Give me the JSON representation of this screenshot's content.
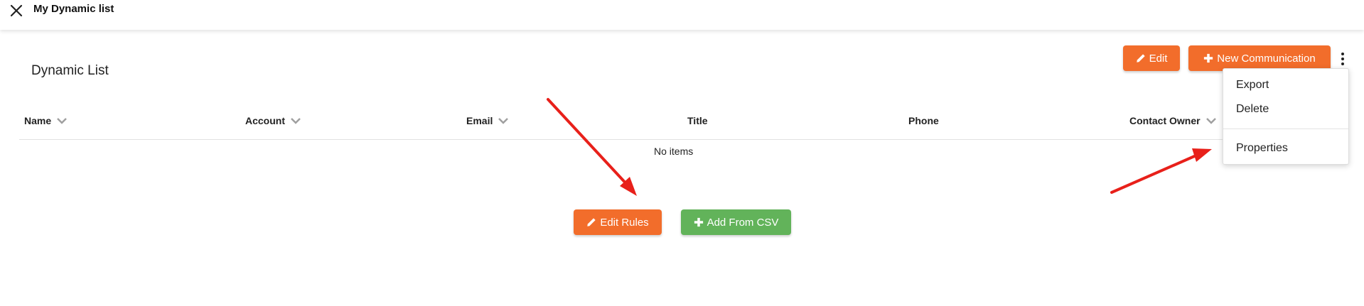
{
  "header": {
    "close_icon": "close-icon",
    "title": "My Dynamic list"
  },
  "list": {
    "title": "Dynamic List"
  },
  "toolbar": {
    "edit_label": "Edit",
    "new_communication_label": "New Communication",
    "more_icon": "vertical-dots-icon"
  },
  "table": {
    "columns": [
      {
        "label": "Name",
        "sortable": true
      },
      {
        "label": "Account",
        "sortable": true
      },
      {
        "label": "Email",
        "sortable": true
      },
      {
        "label": "Title",
        "sortable": false
      },
      {
        "label": "Phone",
        "sortable": false
      },
      {
        "label": "Contact Owner",
        "sortable": true
      }
    ],
    "empty_text": "No items"
  },
  "actions": {
    "edit_rules_label": "Edit Rules",
    "add_from_csv_label": "Add From CSV"
  },
  "menu": {
    "items": [
      {
        "label": "Export"
      },
      {
        "label": "Delete"
      },
      {
        "label": "Properties"
      }
    ]
  },
  "colors": {
    "orange": "#f26d2b",
    "green": "#62b35a",
    "annotation_arrow": "#e8201a"
  }
}
